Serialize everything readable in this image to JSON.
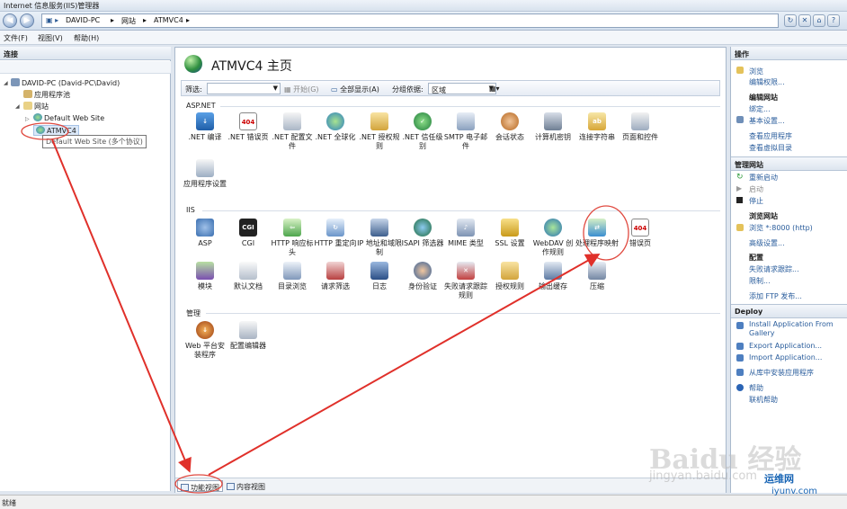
{
  "window": {
    "title": "Internet 信息服务(IIS)管理器"
  },
  "address": {
    "crumbs": [
      "DAVID-PC",
      "网站",
      "ATMVC4"
    ]
  },
  "menu": {
    "items": [
      "文件(F)",
      "视图(V)",
      "帮助(H)"
    ]
  },
  "connections": {
    "header": "连接",
    "tree": [
      "DAVID-PC (David-PC\\David)",
      "应用程序池",
      "网站",
      "Default Web Site",
      "ATMVC4"
    ],
    "tooltip": "Default Web Site (多个协议)"
  },
  "center": {
    "title": "ATMVC4 主页",
    "filter": {
      "label": "筛选:",
      "start": "开始(G)",
      "showall": "全部显示(A)",
      "groupby": "分组依据:",
      "groupval": "区域"
    },
    "sections": {
      "aspnet": {
        "title": "ASP.NET",
        "items": [
          ".NET 编译",
          ".NET 错误页",
          ".NET 配置文件",
          ".NET 全球化",
          ".NET 授权规则",
          ".NET 信任级别",
          "SMTP 电子邮件",
          "会话状态",
          "计算机密钥",
          "连接字符串",
          "页面和控件",
          "应用程序设置"
        ]
      },
      "iis": {
        "title": "IIS",
        "items": [
          "ASP",
          "CGI",
          "HTTP 响应标头",
          "HTTP 重定向",
          "IP 地址和域限制",
          "ISAPI 筛选器",
          "MIME 类型",
          "SSL 设置",
          "WebDAV 创作规则",
          "处理程序映射",
          "错误页",
          "模块",
          "默认文档",
          "目录浏览",
          "请求筛选",
          "日志",
          "身份验证",
          "失败请求跟踪规则",
          "授权规则",
          "输出缓存",
          "压缩"
        ]
      },
      "mgmt": {
        "title": "管理",
        "items": [
          "Web 平台安装程序",
          "配置编辑器"
        ]
      }
    },
    "tabs": [
      "功能视图",
      "内容视图"
    ],
    "cgi_badge": "CGI",
    "err_badge": "404"
  },
  "actions": {
    "header": "操作",
    "top": [
      "浏览",
      "编辑权限..."
    ],
    "editsite": "编辑网站",
    "editsite_items": [
      "绑定...",
      "基本设置...",
      "查看应用程序",
      "查看虚拟目录"
    ],
    "manage": "管理网站",
    "manage_items": [
      "重新启动",
      "启动",
      "停止"
    ],
    "browse": "浏览网站",
    "browse_item": "浏览 *:8000 (http)",
    "adv": "高级设置...",
    "config": "配置",
    "config_items": [
      "失败请求跟踪...",
      "限制...",
      "添加 FTP 发布..."
    ],
    "deploy": "Deploy",
    "deploy_items": [
      "Install Application From Gallery",
      "Export Application...",
      "Import Application...",
      "从库中安装应用程序"
    ],
    "help": [
      "帮助",
      "联机帮助"
    ]
  },
  "status": {
    "text": "就绪"
  },
  "watermark": {
    "baidu": "Baidu 经验",
    "url": "jingyan.baidu.com",
    "yw": "运维网",
    "yw2": "iyunv.com"
  }
}
